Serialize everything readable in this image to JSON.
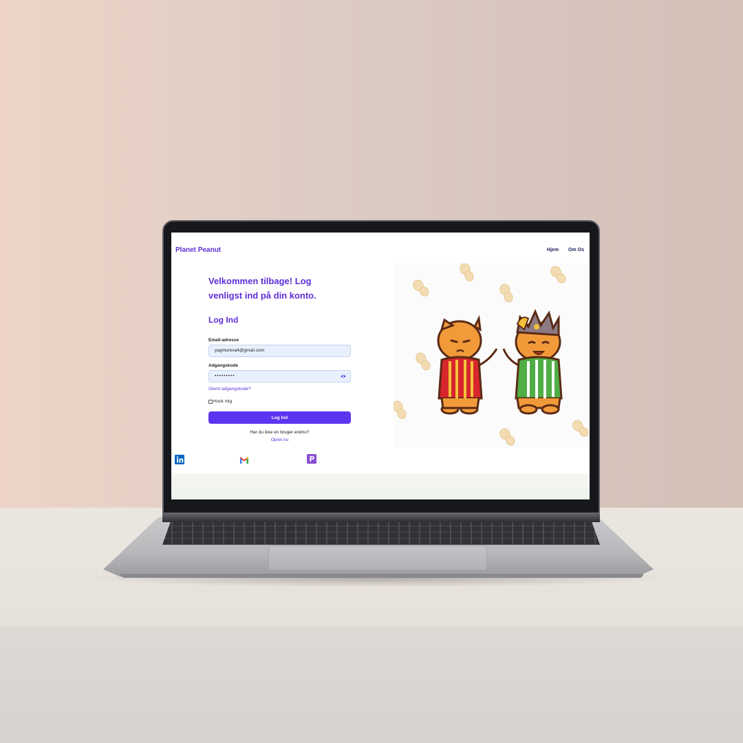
{
  "header": {
    "logo": "Planet Peanut",
    "nav": [
      "Hjem",
      "Om Os"
    ]
  },
  "login": {
    "welcome": "Velkommen tilbage! Log venligst ind på din konto.",
    "title": "Log Ind",
    "email_label": "Email-adresse",
    "email_value": "yagmureva4@gmail.com",
    "password_label": "Adgangskode",
    "password_value": "•••••••••",
    "forgot_link": "Glemt adgangskode?",
    "remember_label": "Husk mig",
    "submit_label": "Log Ind",
    "no_account": "Har du ikke en bruger endnu?",
    "create_link": "Opret nu"
  },
  "footer": {
    "icons": [
      "linkedin-icon",
      "gmail-icon",
      "p-icon"
    ]
  },
  "colors": {
    "brand": "#5b2fd8",
    "button": "#5b35f0",
    "input_bg": "#e8f0fe"
  }
}
